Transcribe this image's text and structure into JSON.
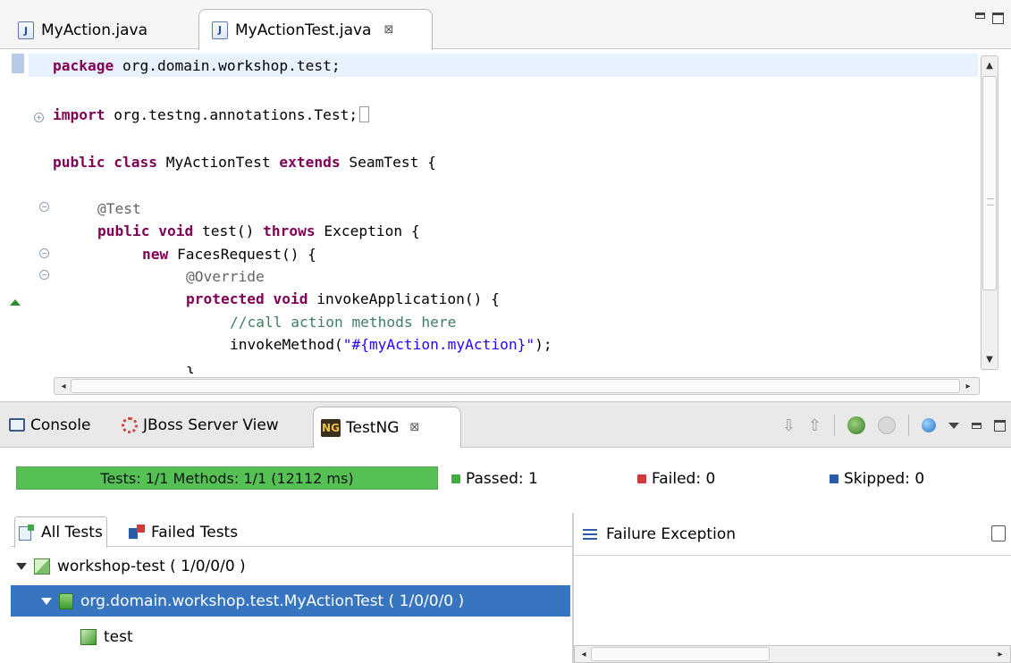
{
  "editor": {
    "tabs": [
      {
        "label": "MyAction.java",
        "icon": "java-file-icon"
      },
      {
        "label": "MyActionTest.java",
        "icon": "java-file-icon",
        "close": "⊠"
      }
    ],
    "code": {
      "l1": {
        "kw": "package",
        "rest": " org.domain.workshop.test;"
      },
      "l2": {
        "kw": "import",
        "rest": " org.testng.annotations.Test;"
      },
      "l3": {
        "kw1": "public class",
        "name": " MyActionTest ",
        "kw2": "extends",
        "rest": " SeamTest {"
      },
      "l4": {
        "ann": "@Test"
      },
      "l5": {
        "kw1": "public void",
        "mid": " test() ",
        "kw2": "throws",
        "rest": " Exception {"
      },
      "l6": {
        "kw": "new",
        "rest": " FacesRequest() {"
      },
      "l7": {
        "ann": "@Override"
      },
      "l8": {
        "kw": "protected void",
        "rest": " invokeApplication() {"
      },
      "l9": {
        "comment": "//call action methods here"
      },
      "l10": {
        "pre": "invokeMethod(",
        "str": "\"#{myAction.myAction}\"",
        "post": ");"
      },
      "l11": {
        "text": "}"
      }
    },
    "scroll": {
      "h_grip": "III"
    }
  },
  "views": {
    "tabs": {
      "console": "Console",
      "jboss": "JBoss Server View",
      "testng": "TestNG",
      "close": "⊠"
    },
    "toolbar": {
      "next_failure": "⇩",
      "prev_failure": "⇧"
    }
  },
  "testng": {
    "progress_label": "Tests: 1/1  Methods: 1/1 (12112 ms)",
    "progress_fraction": 1.0,
    "passed": "Passed: 1",
    "failed": "Failed: 0",
    "skipped": "Skipped: 0",
    "pane_tabs": {
      "all": "All Tests",
      "failed": "Failed Tests"
    },
    "tree": [
      {
        "label": "workshop-test ( 1/0/0/0 )"
      },
      {
        "label": "org.domain.workshop.test.MyActionTest ( 1/0/0/0 )"
      },
      {
        "label": "test"
      }
    ],
    "failure_header": "Failure Exception",
    "r_grip": "III"
  },
  "colors": {
    "progress_fill": "#55c155",
    "selection": "#3875c0",
    "keyword": "#7f0055",
    "string": "#2a00ff",
    "comment": "#3f7f5f"
  }
}
